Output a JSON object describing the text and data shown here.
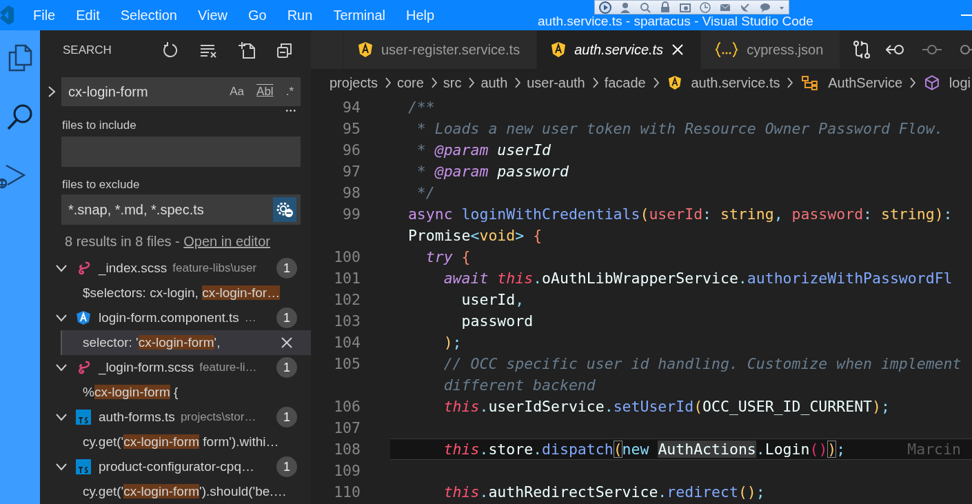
{
  "window": {
    "title": "auth.service.ts - spartacus - Visual Studio Code"
  },
  "menu": [
    "File",
    "Edit",
    "Selection",
    "View",
    "Go",
    "Run",
    "Terminal",
    "Help"
  ],
  "activity_bar": [
    {
      "kind": "files",
      "selected": false
    },
    {
      "kind": "search",
      "selected": true
    },
    {
      "kind": "debug",
      "selected": false
    }
  ],
  "sidebar": {
    "title": "SEARCH",
    "search": {
      "value": "cx-login-form",
      "expanded": false,
      "toggles": [
        {
          "label": "Aa",
          "on": false
        },
        {
          "label": "Abl",
          "on": false
        },
        {
          "label": ".*",
          "on": false
        }
      ]
    },
    "more": "•••",
    "include": {
      "label": "files to include"
    },
    "exclude": {
      "label": "files to exclude",
      "value": "*.snap, *.md, *.spec.ts",
      "settings_on": true
    },
    "summary": "8 results in 8 files - ",
    "summary_link": "Open in editor",
    "results": [
      {
        "kind": "sass",
        "name": "_index.scss",
        "path": "feature-libs\\user",
        "count": "1",
        "expanded": true,
        "matches": [
          {
            "before": "$selectors: cx-login, ",
            "match": "cx-login-for…",
            "selected": false
          }
        ]
      },
      {
        "kind": "angular",
        "name": "login-form.component.ts",
        "path": "…",
        "count": "1",
        "expanded": true,
        "matches": [
          {
            "before": "selector: '",
            "match": "cx-login-form",
            "after": "',",
            "selected": true
          }
        ]
      },
      {
        "kind": "sass",
        "name": "_login-form.scss",
        "path": "feature-li…",
        "count": "1",
        "expanded": true,
        "matches": [
          {
            "before": "%",
            "match": "cx-login-form",
            "after": " {",
            "selected": false
          }
        ]
      },
      {
        "kind": "ts",
        "name": "auth-forms.ts",
        "path": "projects\\stor…",
        "count": "1",
        "expanded": true,
        "matches": [
          {
            "before": "cy.get('",
            "match": "cx-login-form",
            "after": " form').withi…",
            "selected": false
          }
        ]
      },
      {
        "kind": "ts",
        "name": "product-configurator-cpq…",
        "count": "1",
        "expanded": true,
        "matches": [
          {
            "before": "cy.get('",
            "match": "cx-login-form",
            "after": "').should('be.…",
            "selected": false
          }
        ]
      }
    ]
  },
  "tabs": [
    {
      "label": "user-register.service.ts",
      "kind": "angular",
      "selected": false
    },
    {
      "label": "auth.service.ts",
      "kind": "angular",
      "selected": true
    },
    {
      "label": "cypress.json",
      "kind": "json",
      "selected": false
    }
  ],
  "breadcrumbs": [
    {
      "label": "projects",
      "kind": "folder"
    },
    {
      "label": "core",
      "kind": "folder"
    },
    {
      "label": "src",
      "kind": "folder"
    },
    {
      "label": "auth",
      "kind": "folder"
    },
    {
      "label": "user-auth",
      "kind": "folder"
    },
    {
      "label": "facade",
      "kind": "folder"
    },
    {
      "label": "auth.service.ts",
      "kind": "angular"
    },
    {
      "label": "AuthService",
      "kind": "class"
    },
    {
      "label": "logi",
      "kind": "method"
    }
  ],
  "code": [
    {
      "number": "94",
      "current": false,
      "tokens": [
        {
          "kind": "comment",
          "text": "  /**"
        }
      ]
    },
    {
      "number": "95",
      "current": false,
      "tokens": [
        {
          "kind": "comment",
          "text": "   * Loads a new user token with Resource Owner Password Flow."
        }
      ]
    },
    {
      "number": "96",
      "current": false,
      "tokens": [
        {
          "kind": "comment",
          "text": "   * "
        },
        {
          "kind": "doctag",
          "text": "@param"
        },
        {
          "kind": "docparam",
          "text": " userId"
        }
      ]
    },
    {
      "number": "97",
      "current": false,
      "tokens": [
        {
          "kind": "comment",
          "text": "   * "
        },
        {
          "kind": "doctag",
          "text": "@param"
        },
        {
          "kind": "docparam",
          "text": " password"
        }
      ]
    },
    {
      "number": "98",
      "current": false,
      "tokens": [
        {
          "kind": "comment",
          "text": "   */"
        }
      ]
    },
    {
      "number": "99",
      "current": false,
      "tokens": [
        {
          "kind": "keyword",
          "text": "  async "
        },
        {
          "kind": "function",
          "text": "loginWithCredentials"
        },
        {
          "kind": "paren",
          "text": "("
        },
        {
          "kind": "param",
          "text": "userId"
        },
        {
          "kind": "punct",
          "text": ": "
        },
        {
          "kind": "type",
          "text": "string"
        },
        {
          "kind": "punct",
          "text": ", "
        },
        {
          "kind": "param",
          "text": "password"
        },
        {
          "kind": "punct",
          "text": ": "
        },
        {
          "kind": "type",
          "text": "string"
        },
        {
          "kind": "paren",
          "text": ")"
        },
        {
          "kind": "punct",
          "text": ":"
        }
      ]
    },
    {
      "current": false,
      "tokens": [
        {
          "kind": "plain",
          "text": "  Promise"
        },
        {
          "kind": "punct",
          "text": "<"
        },
        {
          "kind": "type",
          "text": "void"
        },
        {
          "kind": "punct",
          "text": "> "
        },
        {
          "kind": "brace",
          "text": "{"
        }
      ]
    },
    {
      "number": "100",
      "current": false,
      "tokens": [
        {
          "kind": "control",
          "text": "    try "
        },
        {
          "kind": "brace",
          "text": "{"
        }
      ]
    },
    {
      "number": "101",
      "current": false,
      "tokens": [
        {
          "kind": "control",
          "text": "      await "
        },
        {
          "kind": "this",
          "text": "this"
        },
        {
          "kind": "punct",
          "text": "."
        },
        {
          "kind": "plain",
          "text": "oAuthLibWrapperService"
        },
        {
          "kind": "punct",
          "text": "."
        },
        {
          "kind": "function",
          "text": "authorizeWithPasswordFl"
        }
      ]
    },
    {
      "number": "102",
      "current": false,
      "tokens": [
        {
          "kind": "plain",
          "text": "        userId"
        },
        {
          "kind": "punct",
          "text": ","
        }
      ]
    },
    {
      "number": "103",
      "current": false,
      "tokens": [
        {
          "kind": "plain",
          "text": "        password"
        }
      ]
    },
    {
      "number": "104",
      "current": false,
      "tokens": [
        {
          "kind": "paren",
          "text": "      )"
        },
        {
          "kind": "punct",
          "text": ";"
        }
      ]
    },
    {
      "number": "105",
      "current": false,
      "tokens": [
        {
          "kind": "comment",
          "text": "      // OCC specific user id handling. Customize when implement"
        }
      ]
    },
    {
      "current": false,
      "tokens": [
        {
          "kind": "comment",
          "text": "      different backend"
        }
      ]
    },
    {
      "number": "106",
      "current": false,
      "tokens": [
        {
          "kind": "this",
          "text": "      this"
        },
        {
          "kind": "punct",
          "text": "."
        },
        {
          "kind": "plain",
          "text": "userIdService"
        },
        {
          "kind": "punct",
          "text": "."
        },
        {
          "kind": "function",
          "text": "setUserId"
        },
        {
          "kind": "paren",
          "text": "("
        },
        {
          "kind": "plain",
          "text": "OCC_USER_ID_CURRENT"
        },
        {
          "kind": "paren",
          "text": ")"
        },
        {
          "kind": "punct",
          "text": ";"
        }
      ]
    },
    {
      "number": "107",
      "current": false
    },
    {
      "number": "108",
      "current": true,
      "blame": "Marcin",
      "tokens": [
        {
          "kind": "this",
          "text": "      this"
        },
        {
          "kind": "punct",
          "text": "."
        },
        {
          "kind": "plain",
          "text": "store"
        },
        {
          "kind": "punct",
          "text": "."
        },
        {
          "kind": "function",
          "text": "dispatch"
        },
        {
          "kind": "matched-paren",
          "text": "("
        },
        {
          "kind": "new",
          "text": "new "
        },
        {
          "kind": "highlighted",
          "text": "AuthActions"
        },
        {
          "kind": "punct",
          "text": "."
        },
        {
          "kind": "plain",
          "text": "Login"
        },
        {
          "kind": "paren2",
          "text": "()"
        },
        {
          "kind": "matched-paren",
          "text": ")"
        },
        {
          "kind": "punct",
          "text": ";"
        }
      ]
    },
    {
      "number": "109",
      "current": false
    },
    {
      "number": "110",
      "current": false,
      "tokens": [
        {
          "kind": "this",
          "text": "      this"
        },
        {
          "kind": "punct",
          "text": "."
        },
        {
          "kind": "plain",
          "text": "authRedirectService"
        },
        {
          "kind": "punct",
          "text": "."
        },
        {
          "kind": "function",
          "text": "redirect"
        },
        {
          "kind": "paren",
          "text": "()"
        },
        {
          "kind": "punct",
          "text": ";"
        }
      ]
    }
  ]
}
